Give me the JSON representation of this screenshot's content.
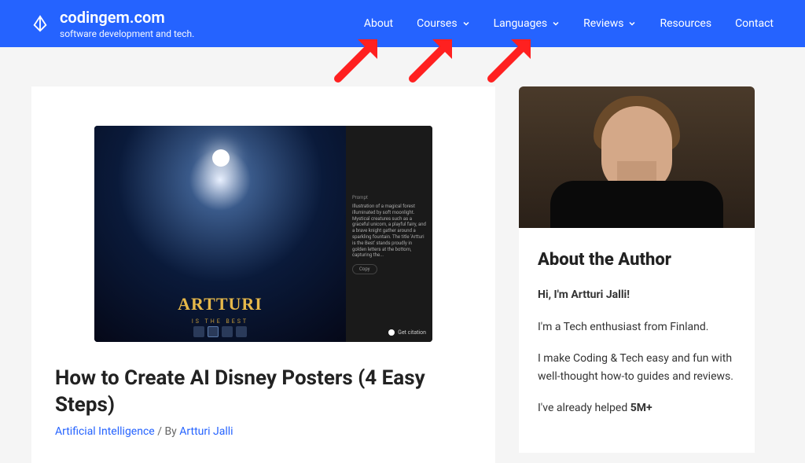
{
  "header": {
    "site_title": "codingem.com",
    "tagline": "software development and tech.",
    "nav": [
      {
        "label": "About",
        "has_dropdown": false
      },
      {
        "label": "Courses",
        "has_dropdown": true
      },
      {
        "label": "Languages",
        "has_dropdown": true
      },
      {
        "label": "Reviews",
        "has_dropdown": true
      },
      {
        "label": "Resources",
        "has_dropdown": false
      },
      {
        "label": "Contact",
        "has_dropdown": false
      }
    ]
  },
  "post": {
    "image_overlay_title": "ARTTURI",
    "image_overlay_sub": "IS THE BEST",
    "prompt_label": "Prompt",
    "prompt_text": "Illustration of a magical forest illuminated by soft moonlight. Mystical creatures such as a graceful unicorn, a playful fairy, and a brave knight gather around a sparkling fountain. The title 'Artturi is the Best' stands proudly in golden letters at the bottom, capturing the...",
    "copy_label": "Copy",
    "get_citation": "Get citation",
    "title": "How to Create AI Disney Posters (4 Easy Steps)",
    "category": "Artificial Intelligence",
    "meta_by": " / By ",
    "author": "Artturi Jalli",
    "excerpt": ""
  },
  "sidebar": {
    "heading": "About the Author",
    "p1": "Hi, I'm Artturi Jalli!",
    "p2": "I'm a Tech enthusiast from Finland.",
    "p3": "I make Coding & Tech easy and fun with well-thought how-to guides and reviews.",
    "p4_prefix": "I've already helped ",
    "p4_bold": "5M+"
  }
}
